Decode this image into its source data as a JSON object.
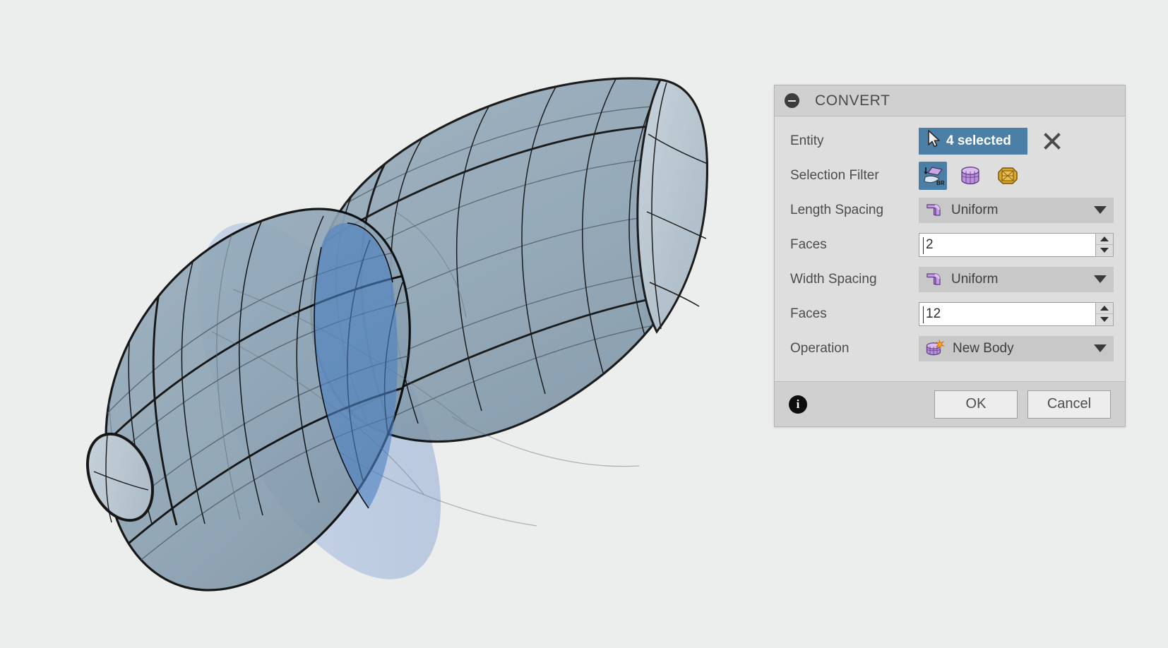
{
  "canvas": {
    "background_color": "#eceded",
    "model_surface_color": "#8ea6b6",
    "model_highlight_color": "#4b7fc0",
    "model_edge_color": "#000000",
    "model_cap_color": "#b8c6d0"
  },
  "dialog": {
    "title": "CONVERT",
    "collapse_icon": "collapse-minus-icon",
    "rows": {
      "entity": {
        "label": "Entity",
        "chip_text": "4 selected",
        "chip_icon": "mouse-cursor-icon",
        "chip_color": "#4b7fa6",
        "clear_icon": "close-x-icon"
      },
      "selection_filter": {
        "label": "Selection Filter",
        "options": [
          {
            "icon": "brep-face-filter-icon",
            "selected": true
          },
          {
            "icon": "tspline-body-filter-icon",
            "selected": false
          },
          {
            "icon": "mesh-body-filter-icon",
            "selected": false
          }
        ]
      },
      "length_spacing": {
        "label": "Length Spacing",
        "value": "Uniform",
        "icon": "uniform-spacing-icon",
        "caret": "chevron-down-icon"
      },
      "length_faces": {
        "label": "Faces",
        "value": "2",
        "stepper_up": "spinner-up-icon",
        "stepper_down": "spinner-down-icon"
      },
      "width_spacing": {
        "label": "Width Spacing",
        "value": "Uniform",
        "icon": "uniform-spacing-icon",
        "caret": "chevron-down-icon"
      },
      "width_faces": {
        "label": "Faces",
        "value": "12",
        "stepper_up": "spinner-up-icon",
        "stepper_down": "spinner-down-icon"
      },
      "operation": {
        "label": "Operation",
        "value": "New Body",
        "icon": "new-body-icon",
        "caret": "chevron-down-icon"
      }
    },
    "footer": {
      "info_icon": "info-icon",
      "ok_label": "OK",
      "cancel_label": "Cancel"
    }
  }
}
